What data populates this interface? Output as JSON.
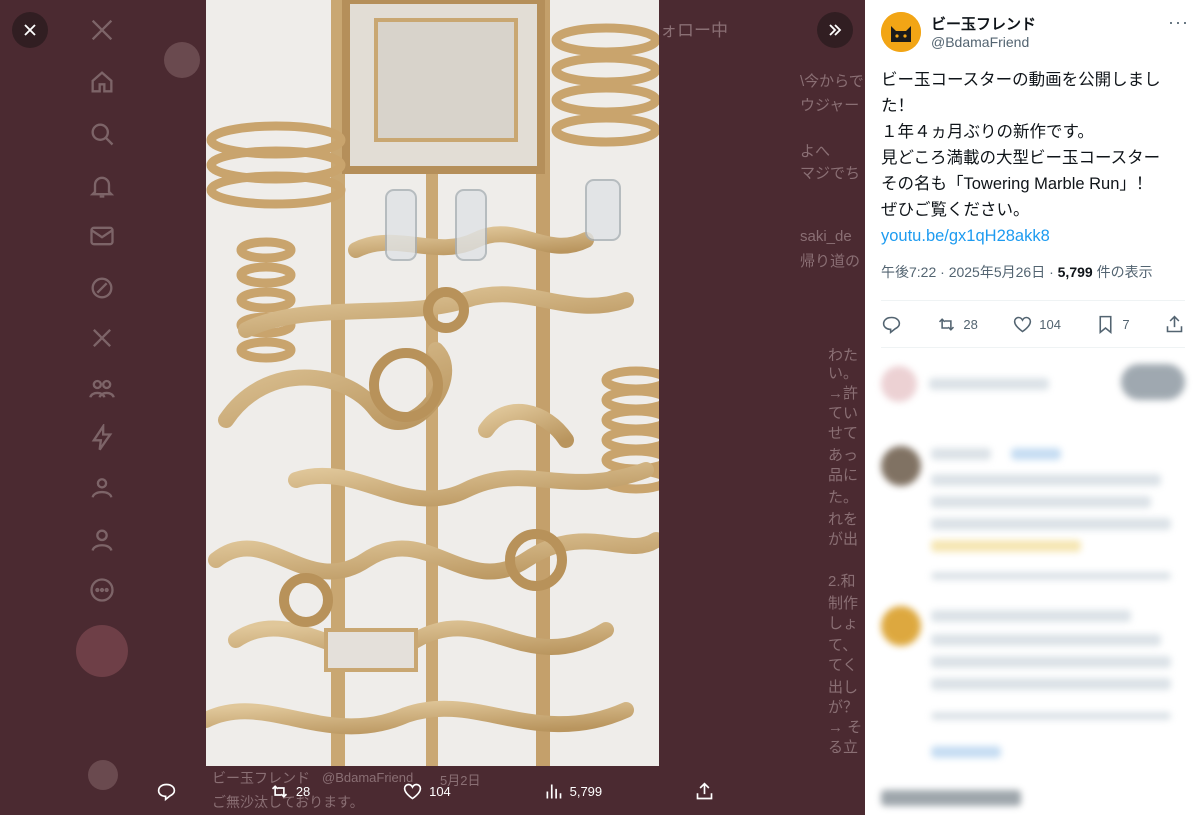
{
  "viewer": {
    "close_icon": "close-icon",
    "expand_icon": "double-chevron-right-icon",
    "media_alt": "Cardboard marble run tower"
  },
  "media_actions": {
    "reply_count": "",
    "retweet_count": "28",
    "like_count": "104",
    "views_count": "5,799"
  },
  "background": {
    "following_label": "ォロー中",
    "ghost_lines": [
      "\\今からで",
      "ウジャー",
      "よへ",
      "マジでち",
      "saki_de",
      "帰り道の",
      "わた",
      "い。",
      "→許",
      "てい",
      "せて",
      "あっ",
      "品に",
      "た。",
      "れを",
      "が出",
      "2.和",
      "制作",
      "しょ",
      "て、",
      "てく",
      "出し",
      "が？",
      "→ そ",
      "る立"
    ],
    "bottom_author": "ビー玉フレンド",
    "bottom_handle": "@BdamaFriend",
    "bottom_date": "5月2日",
    "bottom_text": "ご無沙汰しております。"
  },
  "tweet": {
    "display_name": "ビー玉フレンド",
    "handle": "@BdamaFriend",
    "body_lines": [
      "ビー玉コースターの動画を公開しまし",
      "た！",
      "１年４ヵ月ぶりの新作です。",
      "見どころ満載の大型ビー玉コースター",
      "その名も「Towering Marble Run」！",
      "ぜひご覧ください。"
    ],
    "link": "youtu.be/gx1qH28akk8",
    "time": "午後7:22 · 2025年5月26日 · ",
    "views": "5,799",
    "views_label": " 件の表示",
    "retweets": "28",
    "likes": "104",
    "bookmarks": "7"
  },
  "colors": {
    "backdrop": "#4b2a31",
    "accent": "#1d9bf0",
    "avatar": "#f2a515"
  }
}
